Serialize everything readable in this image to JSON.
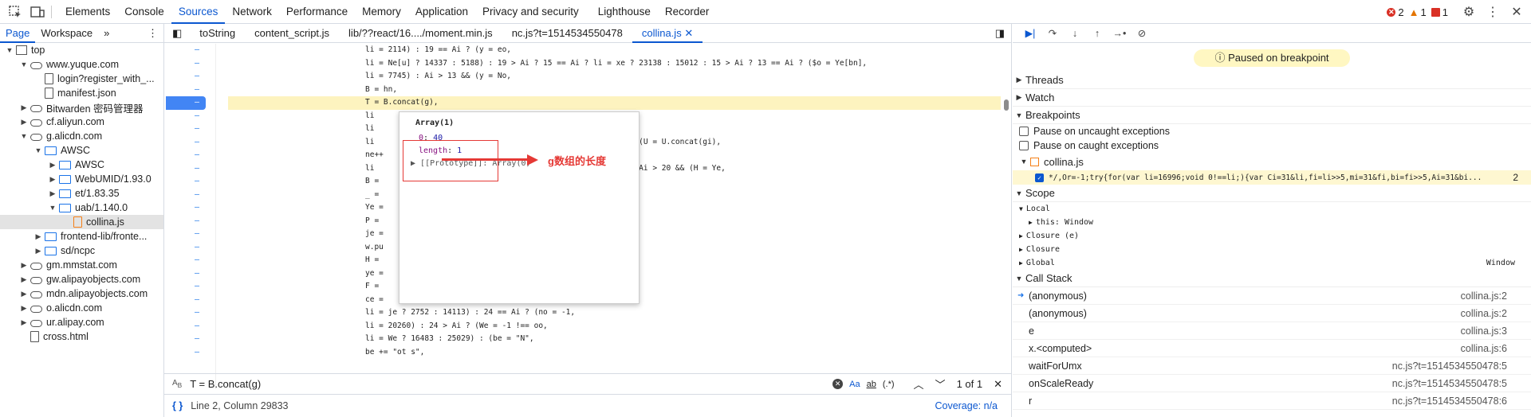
{
  "toolbar": {
    "tabs": [
      "Elements",
      "Console",
      "Sources",
      "Network",
      "Performance",
      "Memory",
      "Application",
      "Privacy and security",
      "Lighthouse",
      "Recorder"
    ],
    "active_tab": "Sources",
    "errors": "2",
    "warnings": "1",
    "issues": "1"
  },
  "navigator": {
    "subtabs": [
      "Page",
      "Workspace"
    ],
    "tree": [
      {
        "label": "top",
        "level": 0,
        "arrow": "▼",
        "icon": "frame"
      },
      {
        "label": "www.yuque.com",
        "level": 1,
        "arrow": "▼",
        "icon": "cloud"
      },
      {
        "label": "login?register_with_...",
        "level": 2,
        "arrow": "",
        "icon": "file"
      },
      {
        "label": "manifest.json",
        "level": 2,
        "arrow": "",
        "icon": "file"
      },
      {
        "label": "Bitwarden 密码管理器",
        "level": 1,
        "arrow": "▶",
        "icon": "cloud"
      },
      {
        "label": "cf.aliyun.com",
        "level": 1,
        "arrow": "▶",
        "icon": "cloud"
      },
      {
        "label": "g.alicdn.com",
        "level": 1,
        "arrow": "▼",
        "icon": "cloud"
      },
      {
        "label": "AWSC",
        "level": 2,
        "arrow": "▼",
        "icon": "folder"
      },
      {
        "label": "AWSC",
        "level": 3,
        "arrow": "▶",
        "icon": "folder"
      },
      {
        "label": "WebUMID/1.93.0",
        "level": 3,
        "arrow": "▶",
        "icon": "folder"
      },
      {
        "label": "et/1.83.35",
        "level": 3,
        "arrow": "▶",
        "icon": "folder"
      },
      {
        "label": "uab/1.140.0",
        "level": 3,
        "arrow": "▼",
        "icon": "folder"
      },
      {
        "label": "collina.js",
        "level": 4,
        "arrow": "",
        "icon": "jsfile",
        "selected": true
      },
      {
        "label": "frontend-lib/fronte...",
        "level": 2,
        "arrow": "▶",
        "icon": "folder"
      },
      {
        "label": "sd/ncpc",
        "level": 2,
        "arrow": "▶",
        "icon": "folder"
      },
      {
        "label": "gm.mmstat.com",
        "level": 1,
        "arrow": "▶",
        "icon": "cloud"
      },
      {
        "label": "gw.alipayobjects.com",
        "level": 1,
        "arrow": "▶",
        "icon": "cloud"
      },
      {
        "label": "mdn.alipayobjects.com",
        "level": 1,
        "arrow": "▶",
        "icon": "cloud"
      },
      {
        "label": "o.alicdn.com",
        "level": 1,
        "arrow": "▶",
        "icon": "cloud"
      },
      {
        "label": "ur.alipay.com",
        "level": 1,
        "arrow": "▶",
        "icon": "cloud"
      },
      {
        "label": "cross.html",
        "level": 1,
        "arrow": "",
        "icon": "file"
      }
    ]
  },
  "editor": {
    "tabs": [
      "toString",
      "content_script.js",
      "lib/??react/16..../moment.min.js",
      "nc.js?t=1514534550478",
      "collina.js"
    ],
    "active_tab": "collina.js",
    "code_lines": [
      "li = 2114) : 19 == Ai ? (y = eo,",
      "li = Ne[u] ? 14337 : 5188) : 19 > Ai ? 15 == Ai ? li = xe ? 23138 : 15012 : 15 > Ai ? 13 == Ai ? ($o = Ye[bn],",
      "li = 7745) : Ai > 13 && (y = No,",
      "B = hn,",
      "T = B.concat(g),",
      "li",
      "li",
      "li                                                     Ai ? (U = U.concat(gi),",
      "ne++",
      "li                                                     40 : Ai > 20 && (H = Ye,",
      "B =",
      "_ =",
      "Ye =",
      "P =",
      "je =",
      "w.pu",
      "H =",
      "ye =",
      "F =",
      "ce =",
      "li = je ? 2752 : 14113) : 24 == Ai ? (no = -1,",
      "li = 20260) : 24 > Ai ? (We = -1 !== oo,",
      "li = We ? 16483 : 25029) : (be = \"N\",",
      "be += \"ot s\","
    ],
    "highlight_line": 4,
    "popover": {
      "title": "Array(1)",
      "prop0_key": "0",
      "prop0_val": "40",
      "length_key": "length",
      "length_val": "1",
      "proto": "[[Prototype]]: Array(0)"
    },
    "annotation": "g数组的长度",
    "search": {
      "query": "T = B.concat(g)",
      "aa": "Aa",
      "ab": "ab",
      "regex": ".*",
      "count": "1 of 1"
    },
    "status": {
      "position": "Line 2, Column 29833",
      "coverage": "Coverage: n/a"
    }
  },
  "debugger": {
    "paused_label": "Paused on breakpoint",
    "sections": {
      "threads": "Threads",
      "watch": "Watch",
      "breakpoints": "Breakpoints",
      "scope": "Scope",
      "callstack": "Call Stack"
    },
    "pause_uncaught": "Pause on uncaught exceptions",
    "pause_caught": "Pause on caught exceptions",
    "bp_file": "collina.js",
    "bp_code": "*/,Or=-1;try{for(var li=16996;void 0!==li;){var Ci=31&li,fi=li>>5,mi=31&fi,bi=fi>>5,Ai=31&bi...",
    "bp_line": "2",
    "scope": {
      "local": "Local",
      "this_label": "this: Window",
      "closure_e": "Closure (e)",
      "closure": "Closure",
      "global": "Global",
      "global_val": "Window"
    },
    "callstack": [
      {
        "fn": "(anonymous)",
        "loc": "collina.js:2",
        "current": true
      },
      {
        "fn": "(anonymous)",
        "loc": "collina.js:2"
      },
      {
        "fn": "e",
        "loc": "collina.js:3"
      },
      {
        "fn": "x.<computed>",
        "loc": "collina.js:6"
      },
      {
        "fn": "waitForUmx",
        "loc": "nc.js?t=1514534550478:5"
      },
      {
        "fn": "onScaleReady",
        "loc": "nc.js?t=1514534550478:5"
      },
      {
        "fn": "r",
        "loc": "nc.js?t=1514534550478:6"
      }
    ]
  }
}
